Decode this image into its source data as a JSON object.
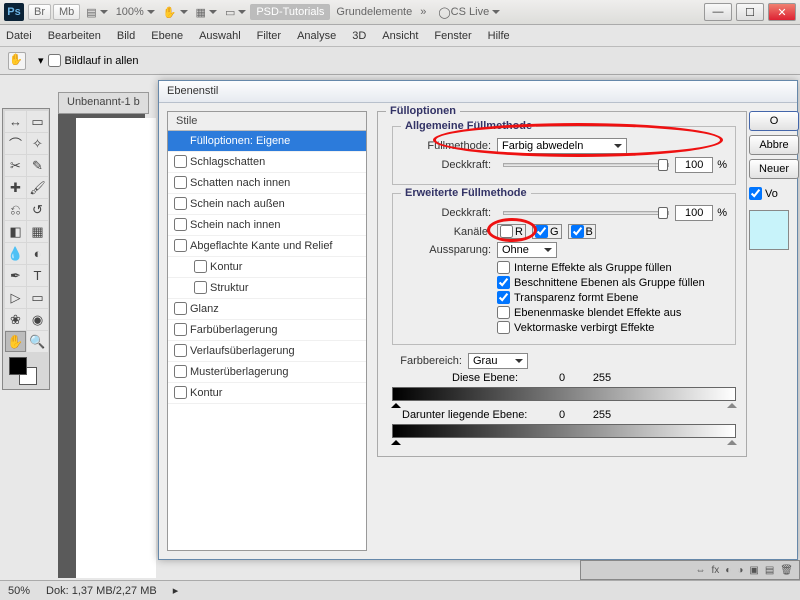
{
  "topbar": {
    "app": "Ps",
    "br": "Br",
    "mb": "Mb",
    "zoom": "100%",
    "tab1": "PSD-Tutorials",
    "tab2": "Grundelemente",
    "cslive": "CS Live"
  },
  "menu": [
    "Datei",
    "Bearbeiten",
    "Bild",
    "Ebene",
    "Auswahl",
    "Filter",
    "Analyse",
    "3D",
    "Ansicht",
    "Fenster",
    "Hilfe"
  ],
  "optbar": {
    "scroll_checkbox_label": "Bildlauf in allen"
  },
  "doc_tab": "Unbenannt-1 b",
  "dialog": {
    "title": "Ebenenstil",
    "styles_header": "Stile",
    "styles": [
      {
        "label": "Fülloptionen: Eigene",
        "selected": true,
        "checkbox": false
      },
      {
        "label": "Schlagschatten",
        "checkbox": true
      },
      {
        "label": "Schatten nach innen",
        "checkbox": true
      },
      {
        "label": "Schein nach außen",
        "checkbox": true
      },
      {
        "label": "Schein nach innen",
        "checkbox": true
      },
      {
        "label": "Abgeflachte Kante und Relief",
        "checkbox": true
      },
      {
        "label": "Kontur",
        "checkbox": true,
        "indent": true
      },
      {
        "label": "Struktur",
        "checkbox": true,
        "indent": true
      },
      {
        "label": "Glanz",
        "checkbox": true
      },
      {
        "label": "Farbüberlagerung",
        "checkbox": true
      },
      {
        "label": "Verlaufsüberlagerung",
        "checkbox": true
      },
      {
        "label": "Musterüberlagerung",
        "checkbox": true
      },
      {
        "label": "Kontur",
        "checkbox": true
      }
    ],
    "fill_title": "Fülloptionen",
    "general": {
      "title": "Allgemeine Füllmethode",
      "mode_label": "Füllmethode:",
      "mode_value": "Farbig abwedeln",
      "opacity_label": "Deckkraft:",
      "opacity_value": "100",
      "pct": "%"
    },
    "advanced": {
      "title": "Erweiterte Füllmethode",
      "opacity_label": "Deckkraft:",
      "opacity_value": "100",
      "pct": "%",
      "channels_label": "Kanäle:",
      "ch_r": "R",
      "ch_g": "G",
      "ch_b": "B",
      "ch_r_checked": false,
      "ch_g_checked": true,
      "ch_b_checked": true,
      "knockout_label": "Aussparung:",
      "knockout_value": "Ohne",
      "checks": [
        {
          "label": "Interne Effekte als Gruppe füllen",
          "checked": false
        },
        {
          "label": "Beschnittene Ebenen als Gruppe füllen",
          "checked": true
        },
        {
          "label": "Transparenz formt Ebene",
          "checked": true
        },
        {
          "label": "Ebenenmaske blendet Effekte aus",
          "checked": false
        },
        {
          "label": "Vektormaske verbirgt Effekte",
          "checked": false
        }
      ]
    },
    "blendif": {
      "label": "Farbbereich:",
      "value": "Grau",
      "this_label": "Diese Ebene:",
      "this_min": "0",
      "this_max": "255",
      "under_label": "Darunter liegende Ebene:",
      "under_min": "0",
      "under_max": "255"
    },
    "buttons": {
      "ok": "O",
      "cancel": "Abbre",
      "newstyle": "Neuer",
      "preview": "Vo"
    }
  },
  "status": {
    "zoom": "50%",
    "doc": "Dok: 1,37 MB/2,27 MB"
  }
}
